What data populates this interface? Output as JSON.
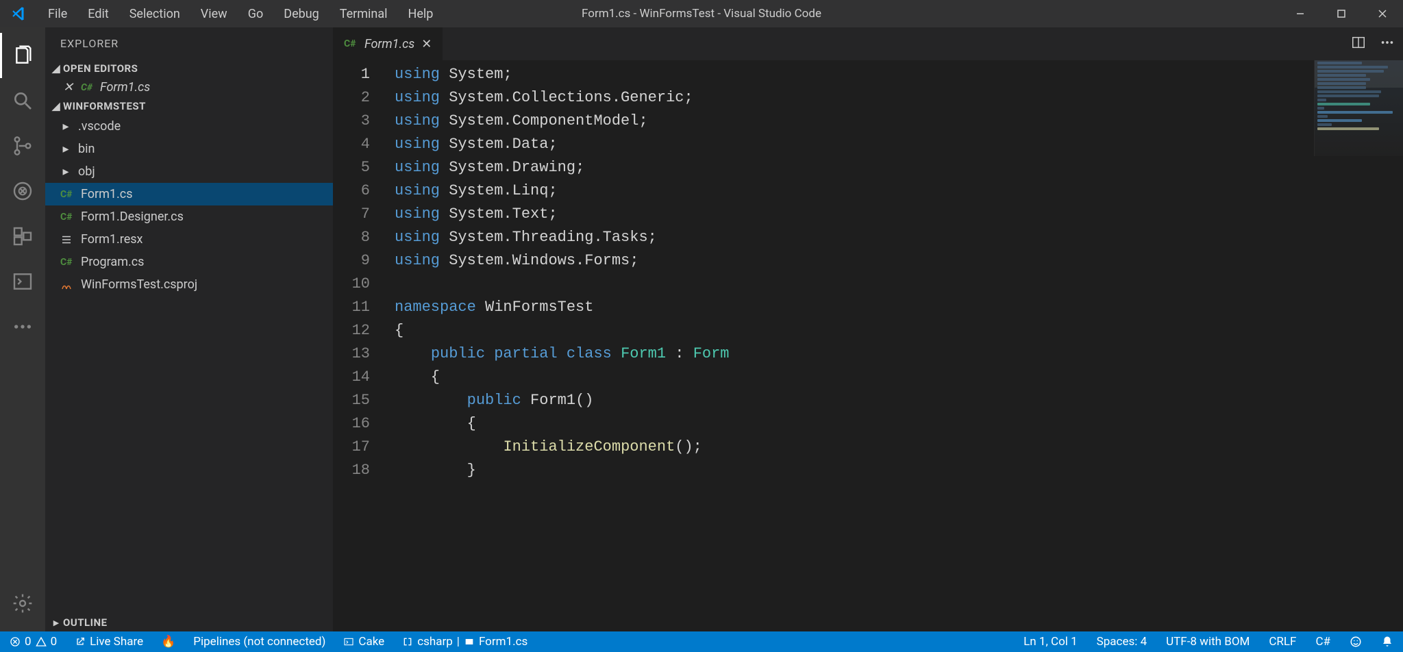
{
  "window": {
    "title": "Form1.cs - WinFormsTest - Visual Studio Code"
  },
  "menus": [
    "File",
    "Edit",
    "Selection",
    "View",
    "Go",
    "Debug",
    "Terminal",
    "Help"
  ],
  "sidebar": {
    "title": "EXPLORER",
    "sections": {
      "open_editors": "OPEN EDITORS",
      "project": "WINFORMSTEST",
      "outline": "OUTLINE"
    },
    "open_file": "Form1.cs",
    "tree": [
      {
        "name": ".vscode",
        "type": "folder"
      },
      {
        "name": "bin",
        "type": "folder"
      },
      {
        "name": "obj",
        "type": "folder"
      },
      {
        "name": "Form1.cs",
        "type": "cs",
        "selected": true
      },
      {
        "name": "Form1.Designer.cs",
        "type": "cs"
      },
      {
        "name": "Form1.resx",
        "type": "resx"
      },
      {
        "name": "Program.cs",
        "type": "cs"
      },
      {
        "name": "WinFormsTest.csproj",
        "type": "csproj"
      }
    ]
  },
  "tab": {
    "label": "Form1.cs"
  },
  "code": {
    "lines": [
      [
        [
          "kw",
          "using"
        ],
        [
          "pl",
          " "
        ],
        [
          "id",
          "System"
        ],
        [
          "pl",
          ";"
        ]
      ],
      [
        [
          "kw",
          "using"
        ],
        [
          "pl",
          " "
        ],
        [
          "id",
          "System.Collections.Generic"
        ],
        [
          "pl",
          ";"
        ]
      ],
      [
        [
          "kw",
          "using"
        ],
        [
          "pl",
          " "
        ],
        [
          "id",
          "System.ComponentModel"
        ],
        [
          "pl",
          ";"
        ]
      ],
      [
        [
          "kw",
          "using"
        ],
        [
          "pl",
          " "
        ],
        [
          "id",
          "System.Data"
        ],
        [
          "pl",
          ";"
        ]
      ],
      [
        [
          "kw",
          "using"
        ],
        [
          "pl",
          " "
        ],
        [
          "id",
          "System.Drawing"
        ],
        [
          "pl",
          ";"
        ]
      ],
      [
        [
          "kw",
          "using"
        ],
        [
          "pl",
          " "
        ],
        [
          "id",
          "System.Linq"
        ],
        [
          "pl",
          ";"
        ]
      ],
      [
        [
          "kw",
          "using"
        ],
        [
          "pl",
          " "
        ],
        [
          "id",
          "System.Text"
        ],
        [
          "pl",
          ";"
        ]
      ],
      [
        [
          "kw",
          "using"
        ],
        [
          "pl",
          " "
        ],
        [
          "id",
          "System.Threading.Tasks"
        ],
        [
          "pl",
          ";"
        ]
      ],
      [
        [
          "kw",
          "using"
        ],
        [
          "pl",
          " "
        ],
        [
          "id",
          "System.Windows.Forms"
        ],
        [
          "pl",
          ";"
        ]
      ],
      [],
      [
        [
          "kw",
          "namespace"
        ],
        [
          "pl",
          " "
        ],
        [
          "id",
          "WinFormsTest"
        ]
      ],
      [
        [
          "pl",
          "{"
        ]
      ],
      [
        [
          "pl",
          "    "
        ],
        [
          "kw",
          "public"
        ],
        [
          "pl",
          " "
        ],
        [
          "kw",
          "partial"
        ],
        [
          "pl",
          " "
        ],
        [
          "kw",
          "class"
        ],
        [
          "pl",
          " "
        ],
        [
          "tp",
          "Form1"
        ],
        [
          "pl",
          " : "
        ],
        [
          "tp",
          "Form"
        ]
      ],
      [
        [
          "pl",
          "    {"
        ]
      ],
      [
        [
          "pl",
          "        "
        ],
        [
          "kw",
          "public"
        ],
        [
          "pl",
          " "
        ],
        [
          "id",
          "Form1"
        ],
        [
          "pl",
          "()"
        ]
      ],
      [
        [
          "pl",
          "        {"
        ]
      ],
      [
        [
          "pl",
          "            "
        ],
        [
          "mt",
          "InitializeComponent"
        ],
        [
          "pl",
          "();"
        ]
      ],
      [
        [
          "pl",
          "        }"
        ]
      ]
    ]
  },
  "status": {
    "errors": "0",
    "warnings": "0",
    "live_share": "Live Share",
    "pipelines": "Pipelines (not connected)",
    "cake": "Cake",
    "csharp": "csharp",
    "active_file": "Form1.cs",
    "ln_col": "Ln 1, Col 1",
    "spaces": "Spaces: 4",
    "encoding": "UTF-8 with BOM",
    "eol": "CRLF",
    "lang": "C#"
  }
}
